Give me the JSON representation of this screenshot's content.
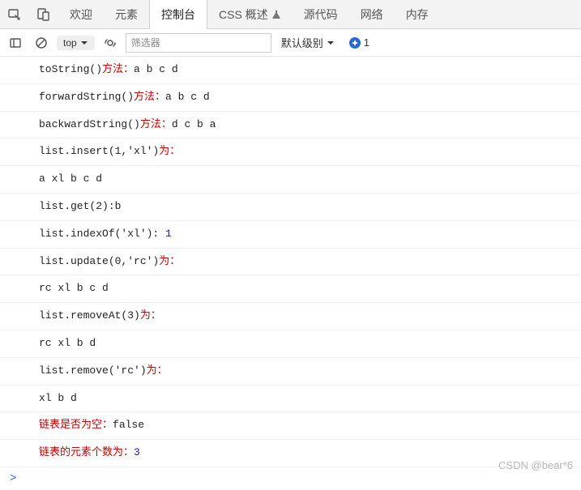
{
  "tabs": {
    "welcome": "欢迎",
    "elements": "元素",
    "console": "控制台",
    "css_overview": "CSS 概述",
    "sources": "源代码",
    "network": "网络",
    "memory": "内存"
  },
  "toolbar": {
    "context": "top",
    "filter_placeholder": "筛选器",
    "log_level": "默认级别",
    "issues_count": "1"
  },
  "logs": [
    {
      "black": "toString()",
      "red": "方法：",
      "tail": "a b c d"
    },
    {
      "black": "forwardString()",
      "red": "方法：",
      "tail": "a b c d"
    },
    {
      "black": "backwardString()",
      "red": "方法：",
      "tail": "d c b a"
    },
    {
      "black": "list.insert(1,'xl')",
      "red": "为：",
      "tail": ""
    },
    {
      "black": "a xl b c d",
      "red": "",
      "tail": ""
    },
    {
      "black": "list.get(2):b",
      "red": "",
      "tail": ""
    },
    {
      "black": "list.indexOf('xl'): ",
      "red": "",
      "tail": "",
      "blue": "1"
    },
    {
      "black": "list.update(0,'rc')",
      "red": "为：",
      "tail": ""
    },
    {
      "black": "rc xl b c d",
      "red": "",
      "tail": ""
    },
    {
      "black": "list.removeAt(3)",
      "red": "为：",
      "tail": ""
    },
    {
      "black": "rc xl b d",
      "red": "",
      "tail": ""
    },
    {
      "black": "list.remove('rc')",
      "red": "为：",
      "tail": ""
    },
    {
      "black": "xl b d",
      "red": "",
      "tail": ""
    },
    {
      "black": "",
      "red": "链表是否为空：",
      "tail": "false"
    },
    {
      "black": "",
      "red": "链表的元素个数为：",
      "tail": "",
      "blue": "3"
    }
  ],
  "prompt": ">",
  "watermark": "CSDN @bear*6"
}
